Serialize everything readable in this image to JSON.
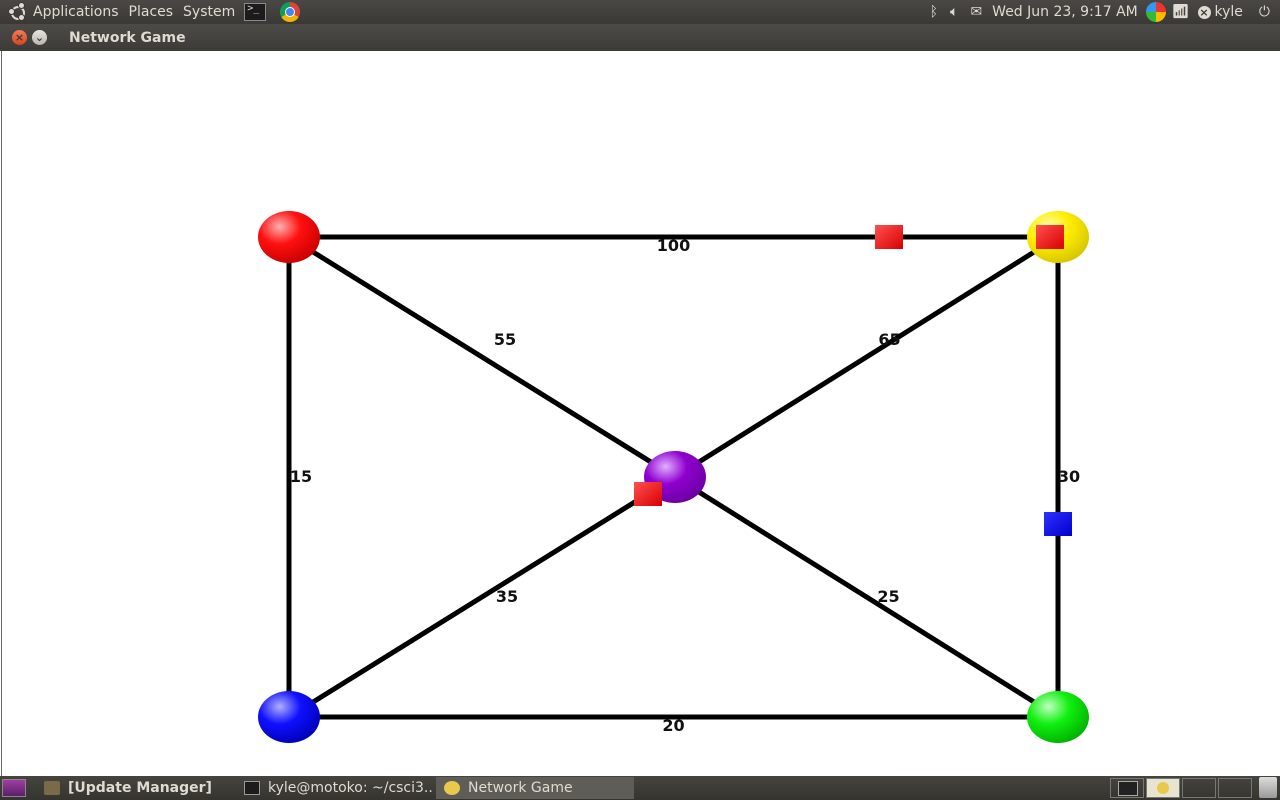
{
  "top_panel": {
    "menus": [
      "Applications",
      "Places",
      "System"
    ],
    "clock": "Wed Jun 23,  9:17 AM",
    "user": "kyle",
    "icons": [
      "ubuntu-logo-icon",
      "terminal-launcher-icon",
      "chrome-icon",
      "bluetooth-icon",
      "volume-icon",
      "mail-icon",
      "sync-icon",
      "wifi-icon",
      "logout-icon",
      "power-icon"
    ]
  },
  "window": {
    "title": "Network Game"
  },
  "chart_data": {
    "type": "graph",
    "nodes": [
      {
        "id": "red",
        "color": "#ff0000"
      },
      {
        "id": "yellow",
        "color": "#ffee00"
      },
      {
        "id": "purple",
        "color": "#8a00c8"
      },
      {
        "id": "blue",
        "color": "#0000ff"
      },
      {
        "id": "green",
        "color": "#00dd00"
      }
    ],
    "edges": [
      {
        "from": "red",
        "to": "yellow",
        "weight": "100"
      },
      {
        "from": "red",
        "to": "purple",
        "weight": "55"
      },
      {
        "from": "yellow",
        "to": "purple",
        "weight": "65"
      },
      {
        "from": "red",
        "to": "blue",
        "weight": "15"
      },
      {
        "from": "yellow",
        "to": "green",
        "weight": "30"
      },
      {
        "from": "blue",
        "to": "purple",
        "weight": "35"
      },
      {
        "from": "purple",
        "to": "green",
        "weight": "25"
      },
      {
        "from": "blue",
        "to": "green",
        "weight": "20"
      }
    ],
    "packets": [
      {
        "color": "#ff0000",
        "on_edge": "red-yellow"
      },
      {
        "color": "#ff0000",
        "at_node": "yellow"
      },
      {
        "color": "#ff0000",
        "at_node": "purple"
      },
      {
        "color": "#0000ff",
        "on_edge": "yellow-green"
      }
    ]
  },
  "taskbar": {
    "tasks": [
      {
        "label": "[Update Manager]"
      },
      {
        "label": "kyle@motoko: ~/csci3..."
      },
      {
        "label": "Network Game"
      }
    ]
  }
}
